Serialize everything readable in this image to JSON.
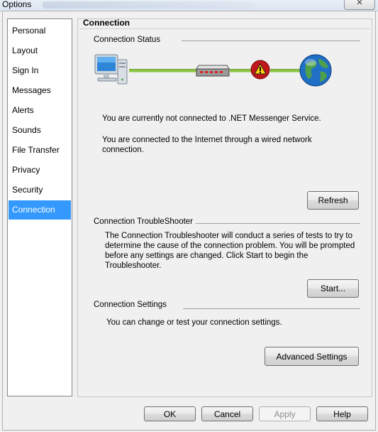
{
  "window": {
    "title": "Options",
    "close_glyph": "✕"
  },
  "sidebar": {
    "items": [
      {
        "label": "Personal"
      },
      {
        "label": "Layout"
      },
      {
        "label": "Sign In"
      },
      {
        "label": "Messages"
      },
      {
        "label": "Alerts"
      },
      {
        "label": "Sounds"
      },
      {
        "label": "File Transfer"
      },
      {
        "label": "Privacy"
      },
      {
        "label": "Security"
      },
      {
        "label": "Connection"
      }
    ],
    "selected": "Connection"
  },
  "panel": {
    "title": "Connection",
    "status": {
      "heading": "Connection Status",
      "not_connected_text": "You are currently not connected to .NET Messenger Service.",
      "internet_text": "You are connected to the Internet through a wired network connection.",
      "refresh_label": "Refresh",
      "icons": [
        "computer-icon",
        "network-hub-icon",
        "warning-icon",
        "globe-icon"
      ]
    },
    "troubleshooter": {
      "heading": "Connection TroubleShooter",
      "description": "The Connection Troubleshooter will conduct a series of tests to try to determine the cause of the connection problem. You will be prompted before any settings are changed. Click Start to begin the Troubleshooter.",
      "start_label": "Start..."
    },
    "settings": {
      "heading": "Connection Settings",
      "description": "You can change or test your connection settings.",
      "advanced_label": "Advanced Settings"
    }
  },
  "footer": {
    "ok_label": "OK",
    "cancel_label": "Cancel",
    "apply_label": "Apply",
    "help_label": "Help"
  },
  "colors": {
    "selection": "#3399ff",
    "wire": "#8ec44a",
    "warning": "#c0171b"
  }
}
